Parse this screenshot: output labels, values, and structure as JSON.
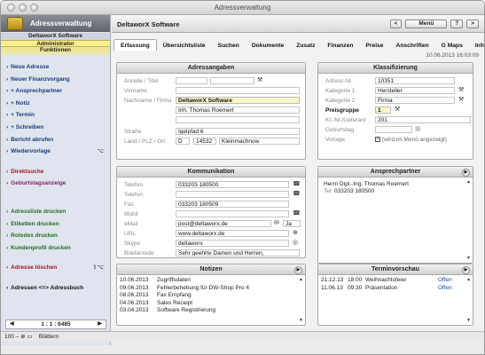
{
  "window": {
    "title": "Adressverwaltung"
  },
  "sidebar": {
    "app_title": "Adressverwaltung",
    "db_name": "DeltaworX Software",
    "user": "Administrator",
    "section": "Funktionen",
    "items": [
      {
        "label": "Neue Adresse",
        "color": "#173c7e",
        "kbd": ""
      },
      {
        "label": "Neuer Finanzvorgang",
        "color": "#173c7e",
        "kbd": ""
      },
      {
        "label": "+ Ansprechpartner",
        "color": "#173c7e",
        "kbd": ""
      },
      {
        "label": "+ Notiz",
        "color": "#173c7e",
        "kbd": ""
      },
      {
        "label": "+ Termin",
        "color": "#173c7e",
        "kbd": ""
      },
      {
        "label": "+ Schreiben",
        "color": "#173c7e",
        "kbd": ""
      },
      {
        "label": "Bericht abrufen",
        "color": "#173c7e",
        "kbd": ""
      },
      {
        "label": "Wiedervorlage",
        "color": "#173c7e",
        "kbd": "⌥"
      }
    ],
    "items2": [
      {
        "label": "Direktsuche",
        "color": "#b20d1b"
      },
      {
        "label": "Geburtstagsanzeige",
        "color": "#8b1e6b"
      }
    ],
    "items3": [
      {
        "label": "Adressliste drucken",
        "color": "#1f6e1f"
      },
      {
        "label": "Etiketten drucken",
        "color": "#1f6e1f"
      },
      {
        "label": "Rolodex drucken",
        "color": "#1f6e1f"
      },
      {
        "label": "Kundenprofil drucken",
        "color": "#1f6e1f"
      }
    ],
    "delete_label": "Adresse löschen",
    "delete_kbd": "⇧⌥",
    "addressbook_label": "Adressen <=> Adressbuch",
    "pager": "1 : 1 : 6485"
  },
  "status": {
    "zoom": "100",
    "mode": "Blättern"
  },
  "main": {
    "header_title": "DeltaworX Software",
    "prev_btn": "<",
    "menu_btn": "Menü",
    "help_btn": "?",
    "next_btn": ">",
    "tabs": [
      "Erfassung",
      "Übersichtsliste",
      "Suchen",
      "Dokumente",
      "Zusatz",
      "Finanzen",
      "Preise",
      "Anschriften",
      "G Maps",
      "Infos"
    ],
    "timestamp": "10.06.2013 16:03:09"
  },
  "adress": {
    "title": "Adressangaben",
    "labels": {
      "anrede": "Anrede / Titel",
      "vorname": "Vorname",
      "nachname": "Nachname / Firma",
      "strasse": "Straße",
      "ort": "Land / PLZ / Ort"
    },
    "nachname": "DeltaworX Software",
    "zusatz": "Inh. Thomas Roemert",
    "strasse": "Igelpfad 6",
    "land": "D",
    "plz": "14532",
    "ort": "Kleinmachnow"
  },
  "klass": {
    "title": "Klassifizierung",
    "labels": {
      "nr": "Adress-Nr.",
      "kat1": "Kategorie 1",
      "kat2": "Kategorie 2",
      "preis": "Preisgruppe",
      "kt": "Kt.-Nr./Lieferant",
      "geb": "Geburtstag",
      "vorlage": "Vorlage"
    },
    "nr": "10351",
    "kat1": "Hersteller",
    "kat2": "Firma",
    "preis": "1",
    "kt": "201",
    "vorlage_note": "(wird im Menü angezeigt)"
  },
  "komm": {
    "title": "Kommunikation",
    "rows": [
      {
        "label": "Telefon",
        "value": "033203 180500"
      },
      {
        "label": "Telefon",
        "value": ""
      },
      {
        "label": "Fax",
        "value": "033203 180509"
      },
      {
        "label": "Mobil",
        "value": ""
      },
      {
        "label": "eMail",
        "value": "post@deltaworx.de"
      },
      {
        "label": "URL",
        "value": "www.deltaworx.de"
      },
      {
        "label": "Skype",
        "value": "deltaworx"
      },
      {
        "label": "Briefanrede",
        "value": "Sehr geehrte Damen und Herren,"
      }
    ],
    "email_flag": "Ja"
  },
  "ansp": {
    "title": "Ansprechpartner",
    "name": "Herrn Dipl.-Ing. Thomas Roemert",
    "tel_label": "Tel:",
    "tel": "033203 180500"
  },
  "notizen": {
    "title": "Notizen",
    "rows": [
      {
        "date": "10.06.2013",
        "text": "Zugriffsdaten"
      },
      {
        "date": "09.06.2013",
        "text": "Fehlerbehebung für DW-Shop Pro 4"
      },
      {
        "date": "08.06.2013",
        "text": "Fax Empfang"
      },
      {
        "date": "04.06.2013",
        "text": "Sales Receipt"
      },
      {
        "date": "03.04.2013",
        "text": "Software Registrierung"
      }
    ]
  },
  "termin": {
    "title": "Terminvorschau",
    "rows": [
      {
        "date": "21.12.13",
        "time": "18:00",
        "text": "Weihnachtsfeier",
        "status": "Offen"
      },
      {
        "date": "11.06.13",
        "time": "09:30",
        "text": "Präsentation",
        "status": "Offen"
      }
    ]
  }
}
